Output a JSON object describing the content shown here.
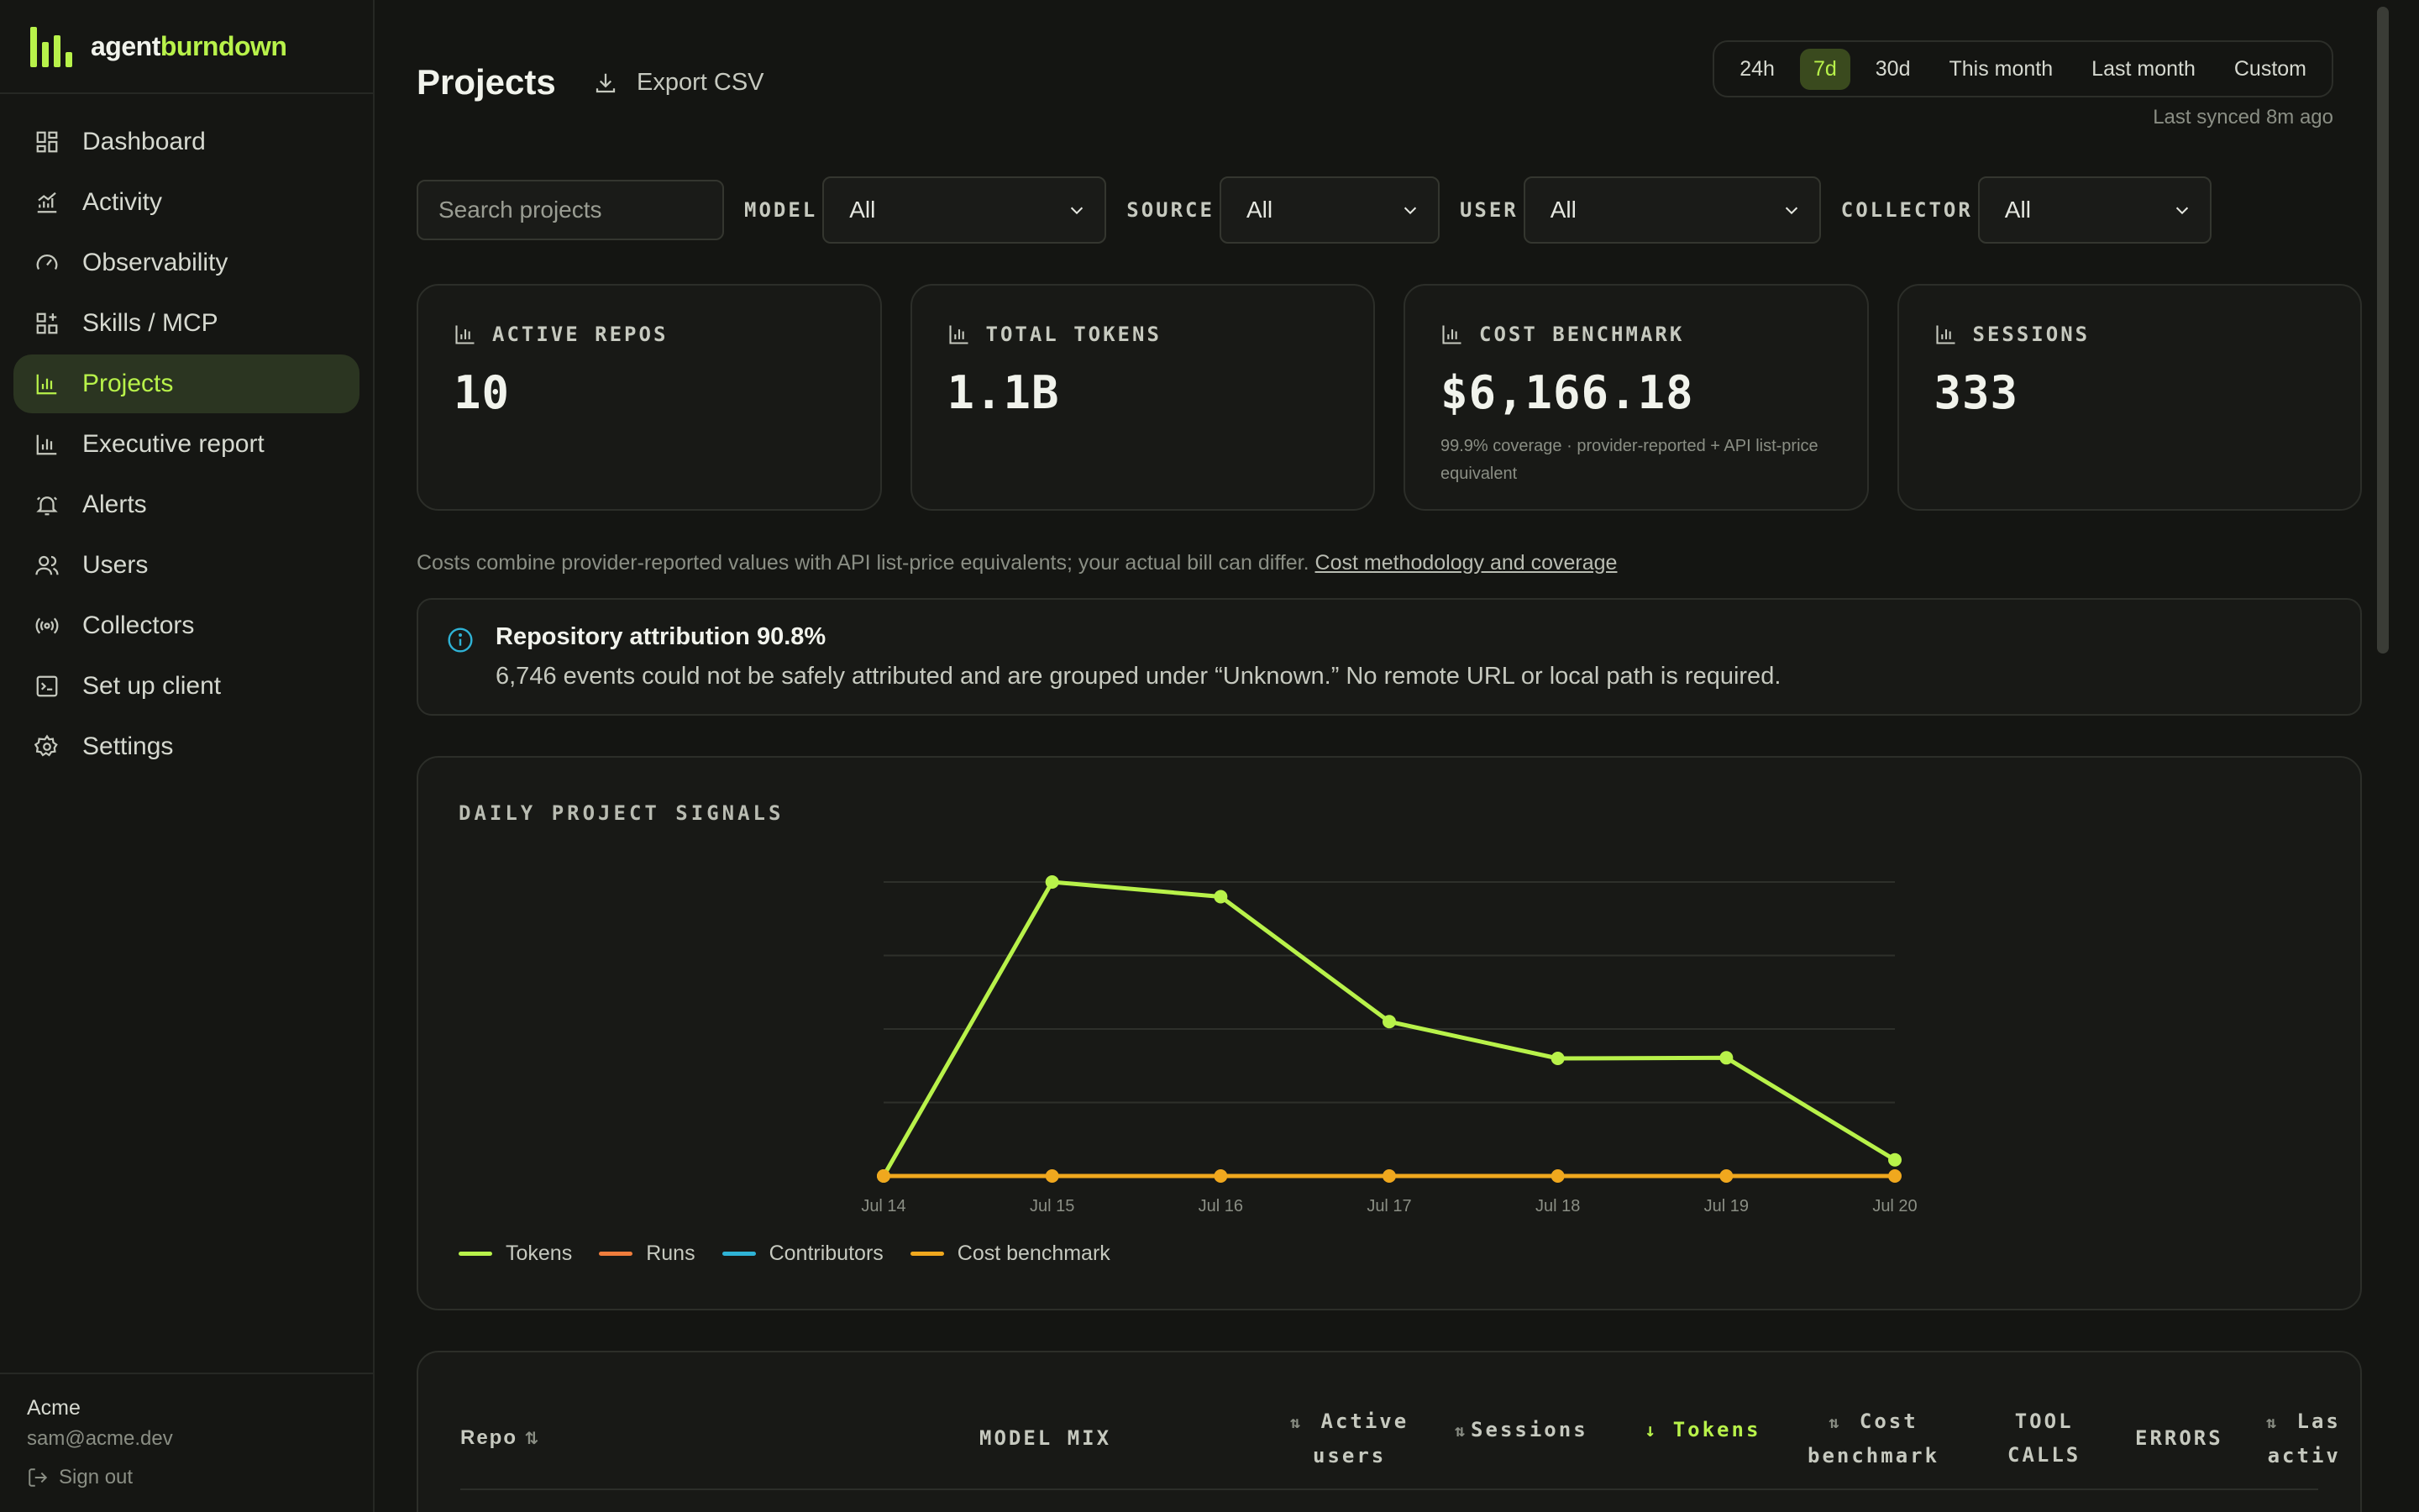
{
  "brand": {
    "name_prefix": "agent",
    "name_suffix": "burndown",
    "accent_color": "#b8f24a"
  },
  "sidebar": {
    "items": [
      {
        "label": "Dashboard",
        "icon": "grid-icon"
      },
      {
        "label": "Activity",
        "icon": "activity-chart-icon"
      },
      {
        "label": "Observability",
        "icon": "gauge-icon"
      },
      {
        "label": "Skills / MCP",
        "icon": "blocks-icon"
      },
      {
        "label": "Projects",
        "icon": "bar-chart-icon",
        "active": true
      },
      {
        "label": "Executive report",
        "icon": "report-chart-icon"
      },
      {
        "label": "Alerts",
        "icon": "bell-icon"
      },
      {
        "label": "Users",
        "icon": "users-icon"
      },
      {
        "label": "Collectors",
        "icon": "broadcast-icon"
      },
      {
        "label": "Set up client",
        "icon": "terminal-icon"
      },
      {
        "label": "Settings",
        "icon": "gear-icon"
      }
    ],
    "footer": {
      "org": "Acme",
      "email": "sam@acme.dev",
      "signout_label": "Sign out"
    }
  },
  "header": {
    "title": "Projects",
    "export_label": "Export CSV",
    "ranges": [
      "24h",
      "7d",
      "30d",
      "This month",
      "Last month",
      "Custom"
    ],
    "active_range": "7d",
    "synced": "Last synced 8m ago"
  },
  "filters": {
    "search_placeholder": "Search projects",
    "model": {
      "label": "MODEL",
      "value": "All"
    },
    "source": {
      "label": "SOURCE",
      "value": "All"
    },
    "user": {
      "label": "USER",
      "value": "All"
    },
    "collector": {
      "label": "COLLECTOR",
      "value": "All"
    }
  },
  "kpis": [
    {
      "label": "ACTIVE REPOS",
      "value": "10"
    },
    {
      "label": "TOTAL TOKENS",
      "value": "1.1B"
    },
    {
      "label": "COST BENCHMARK",
      "value": "$6,166.18",
      "note_line1": "99.9% coverage · provider-reported + API list-price",
      "note_line2": "equivalent"
    },
    {
      "label": "SESSIONS",
      "value": "333"
    }
  ],
  "cost_note": {
    "text": "Costs combine provider-reported values with API list-price equivalents; your actual bill can differ.",
    "link": "Cost methodology and coverage"
  },
  "banner": {
    "title": "Repository attribution 90.8%",
    "text": "6,746 events could not be safely attributed and are grouped under “Unknown.” No remote URL or local path is required."
  },
  "chart_title": "DAILY PROJECT SIGNALS",
  "chart_data": {
    "type": "line",
    "title": "DAILY PROJECT SIGNALS",
    "x": [
      "Jul 14",
      "Jul 15",
      "Jul 16",
      "Jul 17",
      "Jul 18",
      "Jul 19",
      "Jul 20"
    ],
    "ylim": [
      0,
      100
    ],
    "grid": true,
    "legend_placement": "bottom-left",
    "series": [
      {
        "name": "Tokens",
        "color": "#b8f24a",
        "values": [
          0,
          100,
          95,
          52.5,
          40,
          40.2,
          5.5
        ],
        "markers": true
      },
      {
        "name": "Runs",
        "color": "#f07d3c",
        "values": [
          0,
          0,
          0,
          0,
          0,
          0,
          0
        ],
        "markers": false
      },
      {
        "name": "Contributors",
        "color": "#2fb3d6",
        "values": [
          0,
          0,
          0,
          0,
          0,
          0,
          0
        ],
        "markers": false
      },
      {
        "name": "Cost benchmark",
        "color": "#f0a81e",
        "values": [
          0,
          0,
          0,
          0,
          0,
          0,
          0
        ],
        "markers": true
      }
    ]
  },
  "table": {
    "repo": "Repo",
    "model_mix": "MODEL MIX",
    "active_users_1": "Active",
    "active_users_2": "users",
    "sessions": "Sessions",
    "tokens": "Tokens",
    "cost_1": "Cost",
    "cost_2": "benchmark",
    "tool_calls_1": "TOOL",
    "tool_calls_2": "CALLS",
    "errors": "ERRORS",
    "last_active_1": "Las",
    "last_active_2": "activ"
  }
}
